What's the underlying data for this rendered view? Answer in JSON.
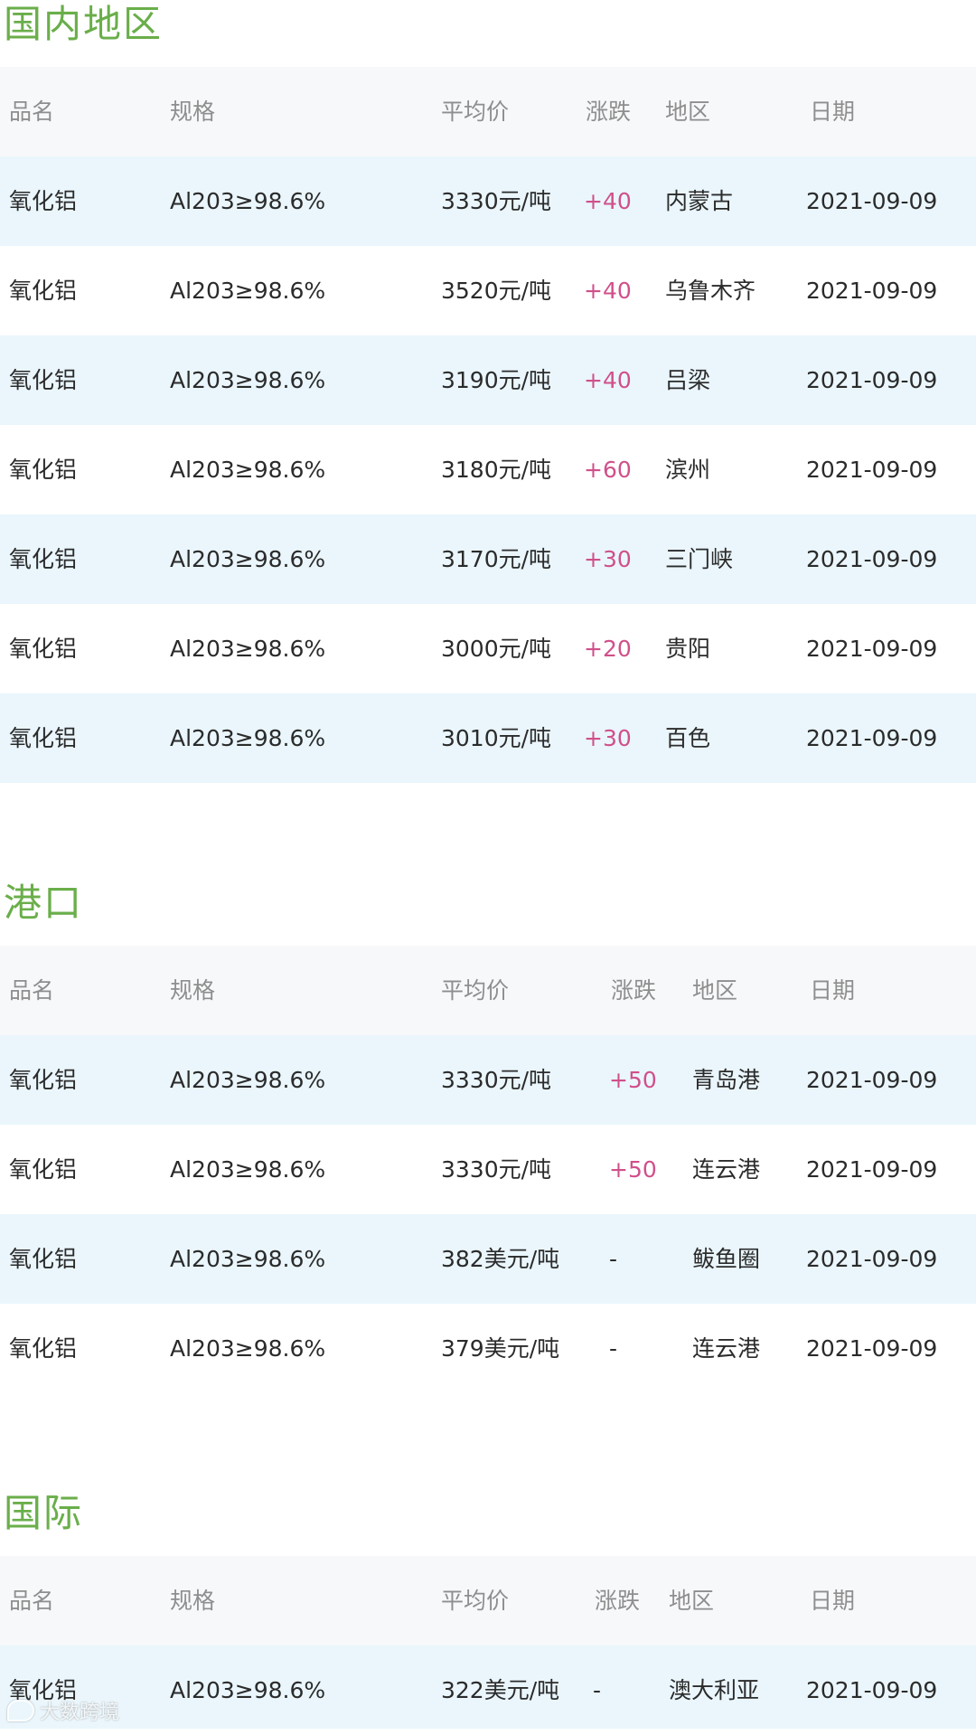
{
  "sections": {
    "domestic": {
      "title": "国内地区",
      "header": {
        "name": "品名",
        "spec": "规格",
        "price": "平均价",
        "change": "涨跌",
        "region": "地区",
        "date": "日期"
      },
      "rows": [
        {
          "name": "氧化铝",
          "spec": "Al203≥98.6%",
          "price": "3330元/吨",
          "change": "+40",
          "region": "内蒙古",
          "date": "2021-09-09"
        },
        {
          "name": "氧化铝",
          "spec": "Al203≥98.6%",
          "price": "3520元/吨",
          "change": "+40",
          "region": "乌鲁木齐",
          "date": "2021-09-09"
        },
        {
          "name": "氧化铝",
          "spec": "Al203≥98.6%",
          "price": "3190元/吨",
          "change": "+40",
          "region": "吕梁",
          "date": "2021-09-09"
        },
        {
          "name": "氧化铝",
          "spec": "Al203≥98.6%",
          "price": "3180元/吨",
          "change": "+60",
          "region": "滨州",
          "date": "2021-09-09"
        },
        {
          "name": "氧化铝",
          "spec": "Al203≥98.6%",
          "price": "3170元/吨",
          "change": "+30",
          "region": "三门峡",
          "date": "2021-09-09"
        },
        {
          "name": "氧化铝",
          "spec": "Al203≥98.6%",
          "price": "3000元/吨",
          "change": "+20",
          "region": "贵阳",
          "date": "2021-09-09"
        },
        {
          "name": "氧化铝",
          "spec": "Al203≥98.6%",
          "price": "3010元/吨",
          "change": "+30",
          "region": "百色",
          "date": "2021-09-09"
        }
      ]
    },
    "port": {
      "title": "港口",
      "header": {
        "name": "品名",
        "spec": "规格",
        "price": "平均价",
        "change": "涨跌",
        "region": "地区",
        "date": "日期"
      },
      "rows": [
        {
          "name": "氧化铝",
          "spec": "Al203≥98.6%",
          "price": "3330元/吨",
          "change": "+50",
          "region": "青岛港",
          "date": "2021-09-09"
        },
        {
          "name": "氧化铝",
          "spec": "Al203≥98.6%",
          "price": "3330元/吨",
          "change": "+50",
          "region": "连云港",
          "date": "2021-09-09"
        },
        {
          "name": "氧化铝",
          "spec": "Al203≥98.6%",
          "price": "382美元/吨",
          "change": "-",
          "region": "鲅鱼圈",
          "date": "2021-09-09"
        },
        {
          "name": "氧化铝",
          "spec": "Al203≥98.6%",
          "price": "379美元/吨",
          "change": "-",
          "region": "连云港",
          "date": "2021-09-09"
        }
      ]
    },
    "international": {
      "title": "国际",
      "header": {
        "name": "品名",
        "spec": "规格",
        "price": "平均价",
        "change": "涨跌",
        "region": "地区",
        "date": "日期"
      },
      "rows": [
        {
          "name": "氧化铝",
          "spec": "Al203≥98.6%",
          "price": "322美元/吨",
          "change": "-",
          "region": "澳大利亚",
          "date": "2021-09-09"
        }
      ]
    }
  },
  "watermark": {
    "text": "大数跨境"
  },
  "colors": {
    "title": "#6aae4a",
    "change": "#d0508a",
    "stripe": "#eaf6fc",
    "header_bg": "#f7f8fa"
  }
}
